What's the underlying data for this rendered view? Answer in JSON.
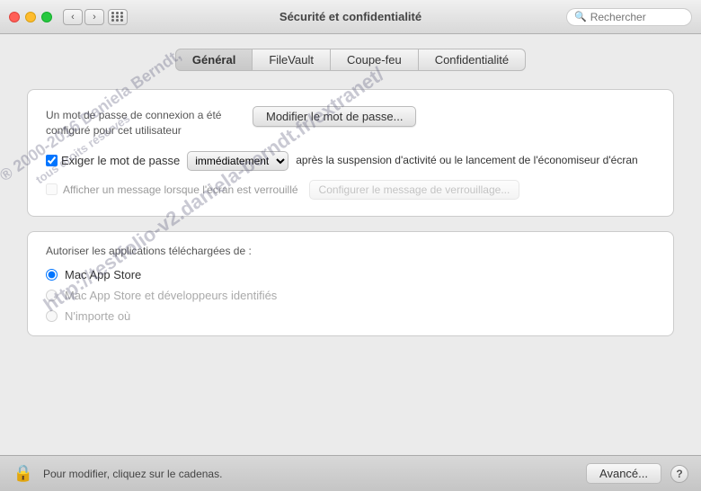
{
  "titlebar": {
    "title": "Sécurité et confidentialité",
    "search_placeholder": "Rechercher"
  },
  "tabs": {
    "items": [
      "Général",
      "FileVault",
      "Coupe-feu",
      "Confidentialité"
    ],
    "active": 0
  },
  "section1": {
    "password_label": "Un mot de passe de connexion a été configuré pour cet utilisateur",
    "modify_btn": "Modifier le mot de passe...",
    "require_checkbox_label": "Exiger le mot de passe",
    "require_select_option": "immédiatement",
    "require_after_text": "après la suspension d'activité ou le lancement de l'économiseur d'écran",
    "message_checkbox_label": "Afficher un message lorsque l'écran est verrouillé",
    "config_btn": "Configurer le message de verrouillage..."
  },
  "section2": {
    "title": "Autoriser les applications téléchargées de :",
    "radio_options": [
      {
        "label": "Mac App Store",
        "checked": true,
        "enabled": true
      },
      {
        "label": "Mac App Store et développeurs identifiés",
        "checked": false,
        "enabled": false
      },
      {
        "label": "N'importe où",
        "checked": false,
        "enabled": false
      }
    ]
  },
  "bottombar": {
    "text": "Pour modifier, cliquez sur le cadenas.",
    "advanced_btn": "Avancé...",
    "help_btn": "?"
  },
  "watermark": {
    "lines": [
      "® 2000-2016 Daniela Berndt,",
      "tous droits réservés",
      "http://testfolio-v2.daniela-berndt.fr/extranet/"
    ]
  }
}
